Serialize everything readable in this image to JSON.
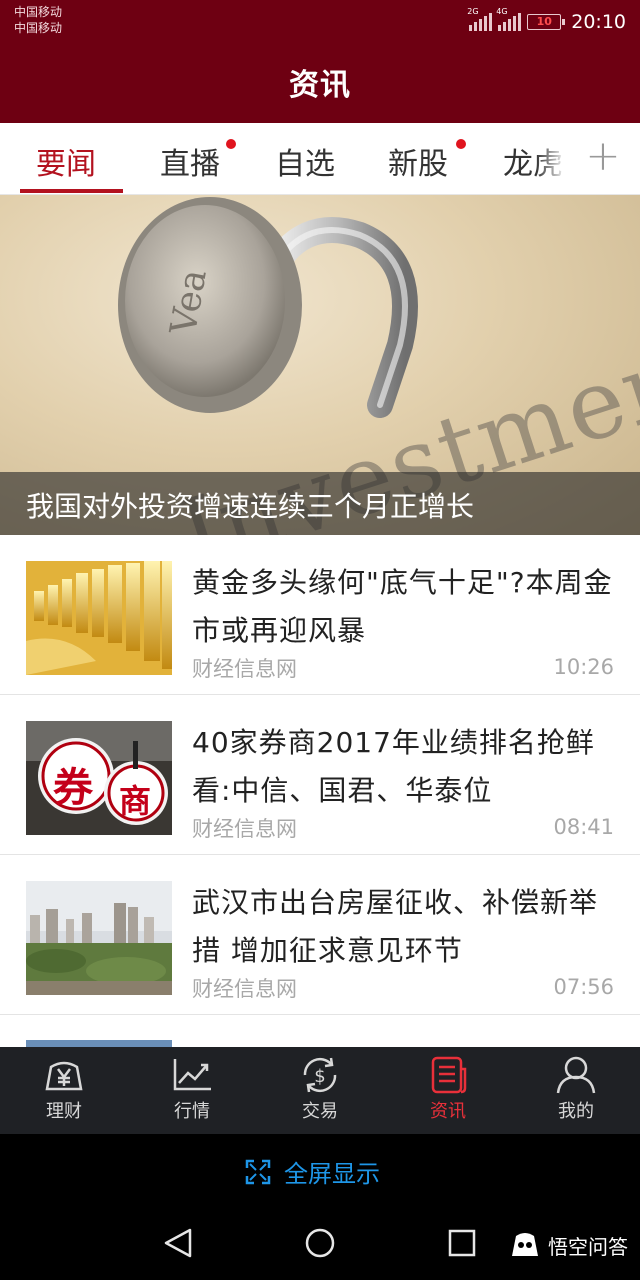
{
  "status": {
    "carrier_1": "中国移动",
    "carrier_2": "中国移动",
    "net_1": "2G",
    "net_2": "4G",
    "battery": "10",
    "time": "20:10"
  },
  "header": {
    "title": "资讯"
  },
  "tabs": [
    {
      "label": "要闻",
      "active": true,
      "dot": false
    },
    {
      "label": "直播",
      "active": false,
      "dot": true
    },
    {
      "label": "自选",
      "active": false,
      "dot": false
    },
    {
      "label": "新股",
      "active": false,
      "dot": true
    },
    {
      "label": "龙虎",
      "active": false,
      "dot": false
    }
  ],
  "add_tab_symbol": "+",
  "hero": {
    "caption": "我国对外投资增速连续三个月正增长",
    "image_text": "Investment"
  },
  "news": [
    {
      "title": "黄金多头缘何\"底气十足\"?本周金市或再迎风暴",
      "source": "财经信息网",
      "time": "10:26",
      "thumb": "gold-bars"
    },
    {
      "title": "40家券商2017年业绩排名抢鲜看:中信、国君、华泰位",
      "source": "财经信息网",
      "time": "08:41",
      "thumb": "broker-signs",
      "thumb_text_1": "券",
      "thumb_text_2": "商"
    },
    {
      "title": "武汉市出台房屋征收、补偿新举措 增加征求意见环节",
      "source": "财经信息网",
      "time": "07:56",
      "thumb": "city-skyline"
    }
  ],
  "bottom_nav": [
    {
      "label": "理财",
      "icon": "yen-icon",
      "active": false
    },
    {
      "label": "行情",
      "icon": "chart-icon",
      "active": false
    },
    {
      "label": "交易",
      "icon": "dollar-exchange-icon",
      "active": false
    },
    {
      "label": "资讯",
      "icon": "news-icon",
      "active": true
    },
    {
      "label": "我的",
      "icon": "user-icon",
      "active": false
    }
  ],
  "fullscreen_label": "全屏显示",
  "watermark": "悟空问答",
  "colors": {
    "header_bg": "#6e0012",
    "accent_red": "#b3121f",
    "nav_bg": "#1f2125",
    "nav_active": "#e8303a",
    "fullscreen_blue": "#1e96e8"
  }
}
